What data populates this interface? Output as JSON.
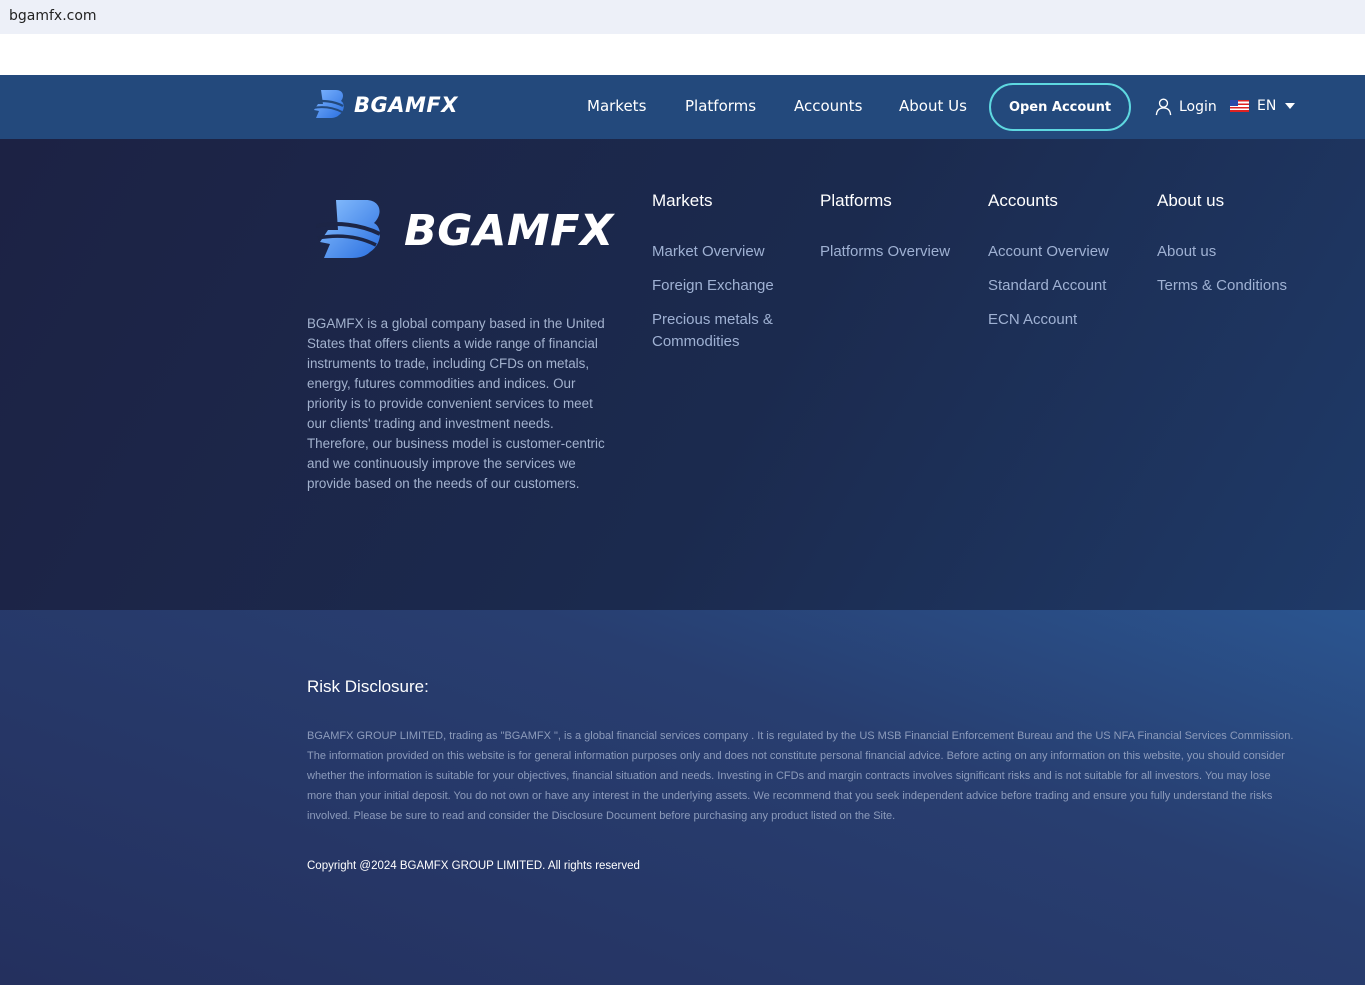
{
  "browser": {
    "url": "bgamfx.com"
  },
  "header": {
    "logo_text": "BGAMFX",
    "nav": [
      "Markets",
      "Platforms",
      "Accounts",
      "About Us"
    ],
    "open_account": "Open Account",
    "login": "Login",
    "language": "EN"
  },
  "footer": {
    "logo_text": "BGAMFX",
    "about": "BGAMFX is a global company based in the United States that offers clients a wide range of financial instruments to trade, including CFDs on metals, energy, futures commodities and indices. Our priority is to provide convenient services to meet our clients' trading and investment needs. Therefore, our business model is customer-centric and we continuously improve the services we provide based on the needs of our customers.",
    "columns": [
      {
        "title": "Markets",
        "links": [
          "Market Overview",
          "Foreign Exchange",
          "Precious metals & Commodities"
        ]
      },
      {
        "title": "Platforms",
        "links": [
          "Platforms Overview"
        ]
      },
      {
        "title": "Accounts",
        "links": [
          "Account Overview",
          "Standard Account",
          "ECN Account"
        ]
      },
      {
        "title": "About us",
        "links": [
          "About us",
          "Terms & Conditions"
        ]
      }
    ],
    "risk_title": "Risk Disclosure:",
    "risk_text": "BGAMFX GROUP LIMITED, trading as \"BGAMFX \", is a global financial services company . It is regulated by the US MSB Financial Enforcement Bureau and the US NFA Financial Services Commission. The information provided on this website is for general information purposes only and does not constitute personal financial advice. Before acting on any information on this website, you should consider whether the information is suitable for your objectives, financial situation and needs. Investing in CFDs and margin contracts involves significant risks and is not suitable for all investors. You may lose more than your initial deposit. You do not own or have any interest in the underlying assets. We recommend that you seek independent advice before trading and ensure you fully understand the risks involved. Please be sure to read and consider the Disclosure Document before purchasing any product listed on the Site.",
    "copyright": "Copyright @2024 BGAMFX GROUP LIMITED. All rights reserved"
  }
}
